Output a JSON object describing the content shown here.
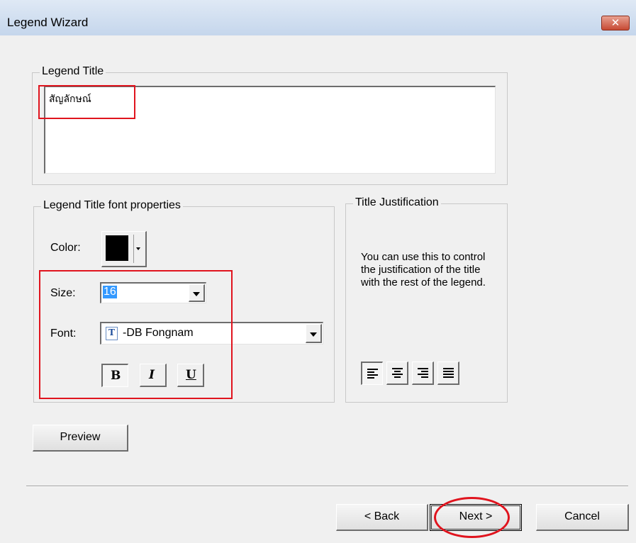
{
  "window": {
    "title": "Legend Wizard",
    "close_label": "✕"
  },
  "legend_title": {
    "group_label": "Legend Title",
    "text": "สัญลักษณ์"
  },
  "font_props": {
    "group_label": "Legend Title font properties",
    "color_label": "Color:",
    "color_value": "#000000",
    "size_label": "Size:",
    "size_value": "16",
    "font_label": "Font:",
    "font_value": "-DB Fongnam",
    "font_icon_glyph": "T",
    "bold": "B",
    "italic": "I",
    "underline": "U"
  },
  "justification": {
    "group_label": "Title Justification",
    "description": "You can use this to control the justification of the title with the rest of the legend.",
    "options": [
      "align-left-icon",
      "align-center-icon",
      "align-right-icon",
      "align-justify-icon"
    ]
  },
  "buttons": {
    "preview": "Preview",
    "back": "< Back",
    "next": "Next >",
    "cancel": "Cancel"
  },
  "annotations": {
    "highlight_color": "#e0141e"
  }
}
